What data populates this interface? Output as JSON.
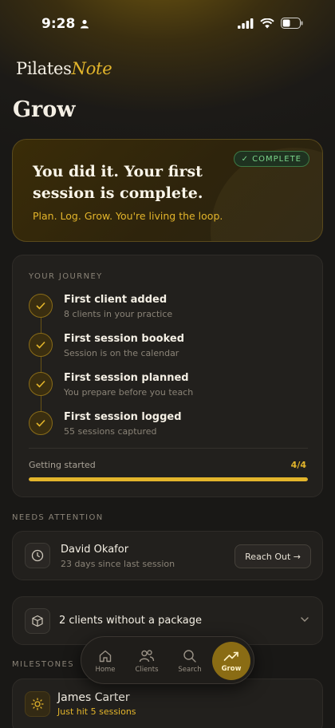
{
  "status": {
    "time": "9:28"
  },
  "brand": {
    "name": "Pilates",
    "accent": "Note"
  },
  "page": {
    "title": "Grow"
  },
  "hero": {
    "badge": "✓ COMPLETE",
    "heading": "You did it. Your first session is complete.",
    "tagline": "Plan. Log. Grow. You're living the loop."
  },
  "journey": {
    "label": "YOUR JOURNEY",
    "steps": [
      {
        "title": "First client added",
        "subtitle": "8 clients in your practice"
      },
      {
        "title": "First session booked",
        "subtitle": "Session is on the calendar"
      },
      {
        "title": "First session planned",
        "subtitle": "You prepare before you teach"
      },
      {
        "title": "First session logged",
        "subtitle": "55 sessions captured"
      }
    ],
    "progress_label": "Getting started",
    "progress_count": "4/4",
    "progress_fraction": 1.0
  },
  "attention": {
    "label": "NEEDS ATTENTION",
    "name": "David Okafor",
    "subtitle": "23 days since last session",
    "button": "Reach Out →"
  },
  "package": {
    "label": "2 clients without a package"
  },
  "milestones": {
    "label": "MILESTONES",
    "name": "James Carter",
    "subtitle": "Just hit 5 sessions"
  },
  "tabs": [
    {
      "label": "Home",
      "icon": "home-icon"
    },
    {
      "label": "Clients",
      "icon": "users-icon"
    },
    {
      "label": "Search",
      "icon": "search-icon"
    },
    {
      "label": "Grow",
      "icon": "trending-up-icon"
    }
  ],
  "colors": {
    "accent": "#e3b52b",
    "success": "#7bd58a",
    "background": "#191816"
  }
}
